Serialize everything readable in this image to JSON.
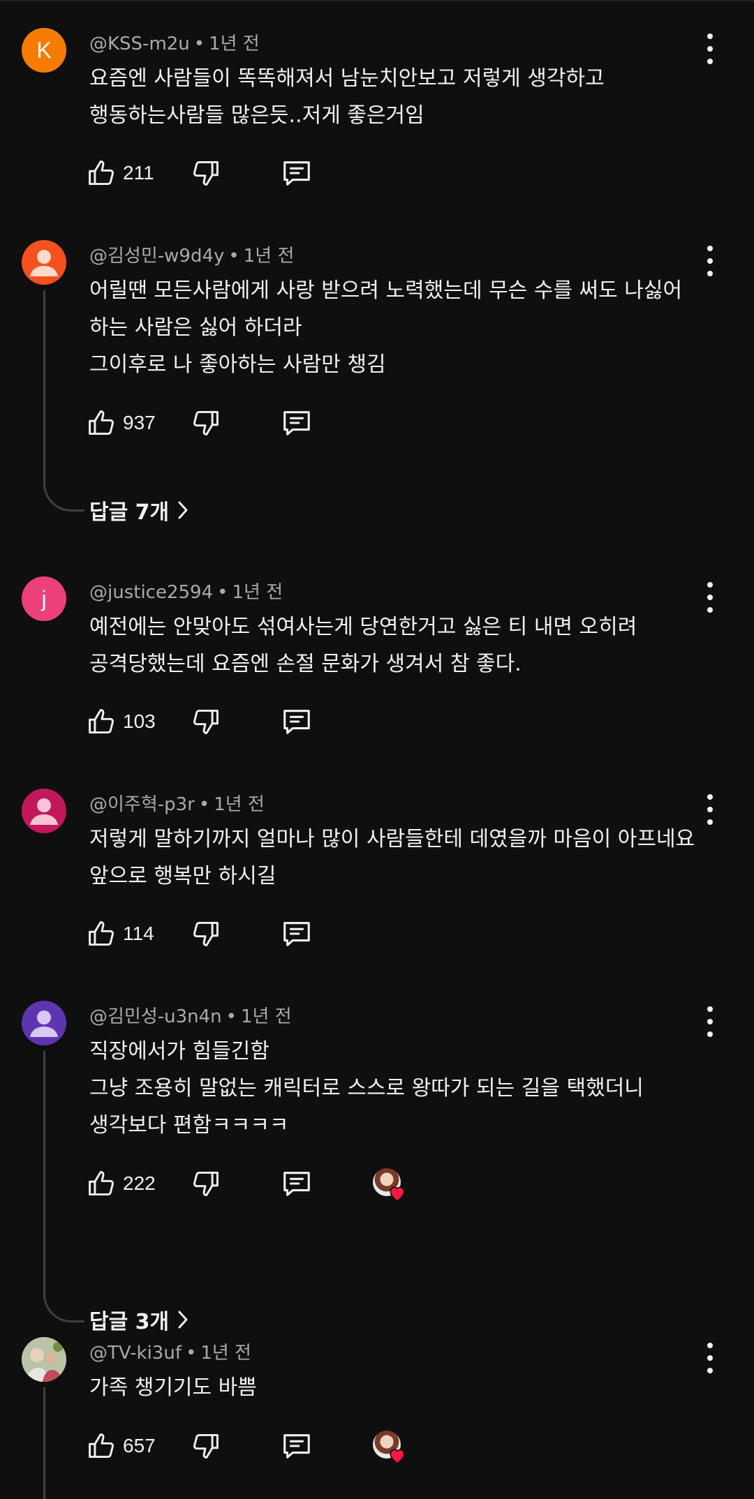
{
  "comments": [
    {
      "author": "@KSS-m2u",
      "time": "1년 전",
      "avatar_letter": "K",
      "avatar_color": "#f57c00",
      "lines": [
        "요즘엔 사람들이 똑똑해져서 남눈치안보고 저렇게 생각하고",
        "행동하는사람들 많은듯..저게 좋은거임"
      ],
      "likes": "211"
    },
    {
      "author": "@김성민-w9d4y",
      "time": "1년 전",
      "avatar_color": "#f4511e",
      "lines": [
        "어릴땐 모든사람에게 사랑 받으려 노력했는데 무슨 수를 써도 나싫어",
        "하는 사람은 싫어 하더라",
        "그이후로 나 좋아하는 사람만 챙김"
      ],
      "likes": "937",
      "replies": "답글 7개"
    },
    {
      "author": "@justice2594",
      "time": "1년 전",
      "avatar_letter": "j",
      "avatar_color": "#ec407a",
      "lines": [
        "예전에는 안맞아도 섞여사는게 당연한거고 싫은 티 내면 오히려",
        "공격당했는데 요즘엔 손절 문화가 생겨서 참 좋다."
      ],
      "likes": "103"
    },
    {
      "author": "@이주혁-p3r",
      "time": "1년 전",
      "avatar_color": "#c2185b",
      "lines": [
        "저렇게 말하기까지 얼마나 많이 사람들한테 데였을까 마음이 아프네요",
        "앞으로 행복만 하시길"
      ],
      "likes": "114"
    },
    {
      "author": "@김민성-u3n4n",
      "time": "1년 전",
      "avatar_color": "#5e35b1",
      "lines": [
        "직장에서가 힘들긴함",
        "그냥 조용히 말없는 캐릭터로 스스로 왕따가 되는 길을 택했더니",
        "생각보다 편함ㅋㅋㅋㅋ"
      ],
      "likes": "222",
      "replies": "답글 3개"
    },
    {
      "author": "@TV-ki3uf",
      "time": "1년 전",
      "avatar_color": "#8d9b7a",
      "lines": [
        "가족 챙기기도 바쁨"
      ],
      "likes": "657"
    }
  ]
}
